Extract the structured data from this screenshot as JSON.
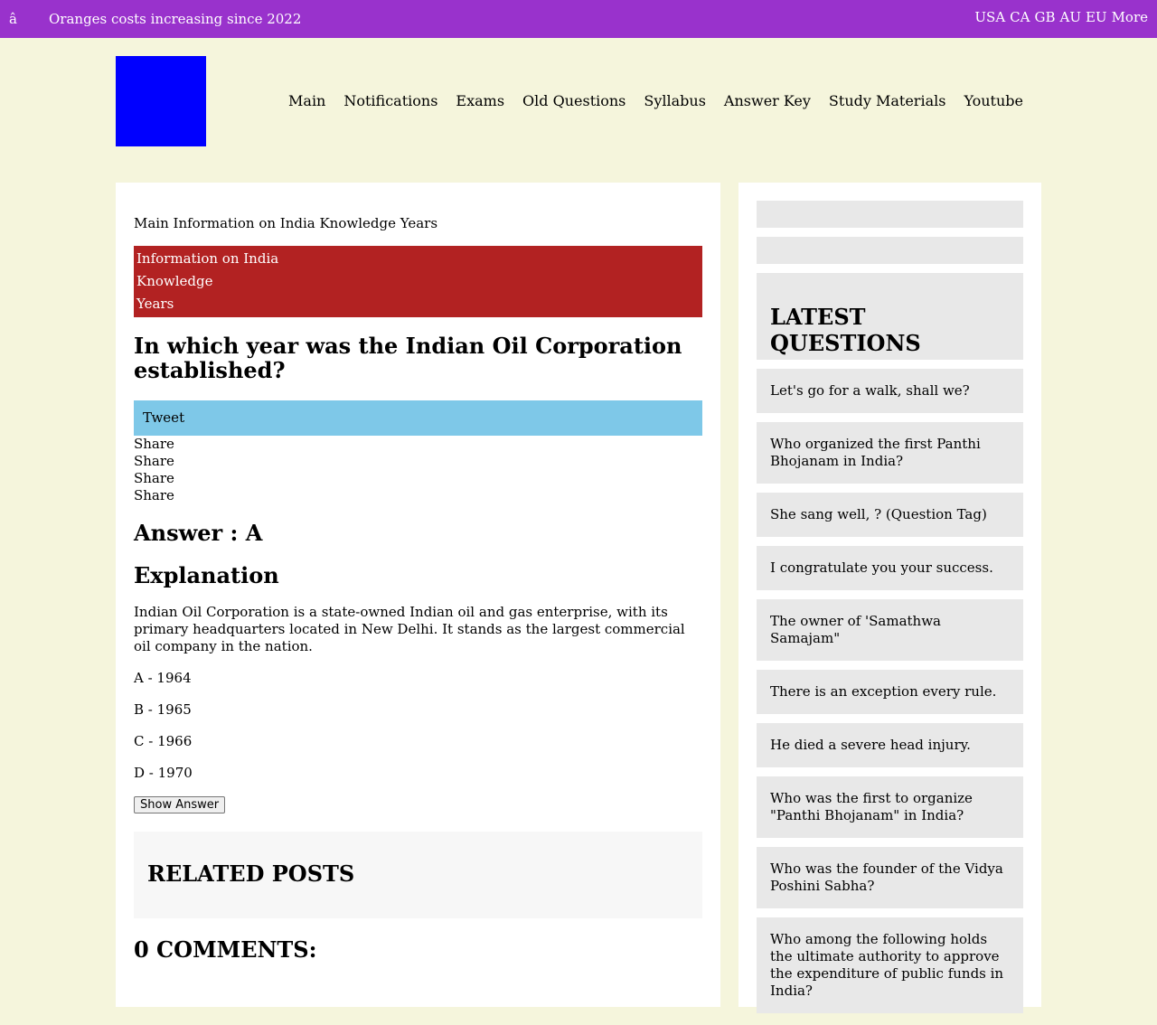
{
  "topbar": {
    "glyph": "â",
    "ticker": "Oranges costs increasing since 2022",
    "regions": [
      "USA",
      "CA",
      "GB",
      "AU",
      "EU",
      "More"
    ],
    "background": "#9932cc"
  },
  "header": {
    "logo_color": "#0000ff",
    "nav": [
      "Main",
      "Notifications",
      "Exams",
      "Old Questions",
      "Syllabus",
      "Answer Key",
      "Study Materials",
      "Youtube"
    ]
  },
  "post": {
    "breadcrumb": "Main Information on India Knowledge Years",
    "labels": [
      "Information on India",
      "Knowledge",
      "Years"
    ],
    "question": "In which year was the Indian Oil Corporation established?",
    "tweet_label": "Tweet",
    "share_labels": [
      "Share",
      "Share",
      "Share",
      "Share"
    ],
    "answer": "Answer : A",
    "explanation_title": "Explanation",
    "explanation_text": "Indian Oil Corporation is a state-owned Indian oil and gas enterprise, with its primary headquarters located in New Delhi. It stands as the largest commercial oil company in the nation.",
    "options": [
      "A - 1964",
      "B - 1965",
      "C - 1966",
      "D - 1970"
    ],
    "show_answer_label": "Show Answer",
    "related_title": "RELATED POSTS",
    "comments_title": "0 COMMENTS:"
  },
  "sidebar": {
    "heading": "LATEST QUESTIONS",
    "items": [
      "Let's go for a walk, shall we?",
      "Who organized the first Panthi Bhojanam in India?",
      "She sang well, ? (Question Tag)",
      "I congratulate you your success.",
      "The owner of 'Samathwa Samajam\"",
      "There is an exception every rule.",
      "He died a severe head injury.",
      "Who was the first to organize \"Panthi Bhojanam\" in India?",
      "Who was the founder of the Vidya Poshini Sabha?",
      "Who among the following holds the ultimate authority to approve the expenditure of public funds in India?"
    ]
  }
}
